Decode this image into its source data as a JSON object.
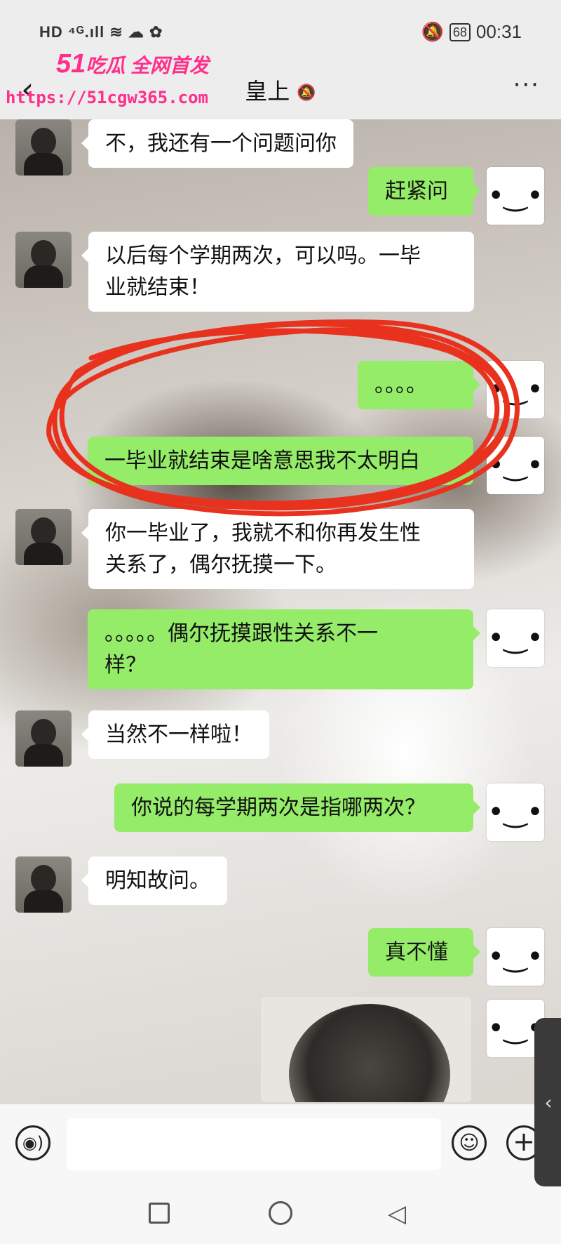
{
  "status_bar": {
    "left_indicators": "HD ⁴ᴳ.ıll ≋ ☁ ✿",
    "battery": "68",
    "time": "00:31"
  },
  "header": {
    "back_icon": "‹",
    "title": "皇上",
    "mute_icon": "🔕",
    "more_icon": "···"
  },
  "watermark": {
    "brand": "51",
    "tagline": "吃瓜 全网首发",
    "url": "https://51cgw365.com"
  },
  "messages": [
    {
      "side": "in",
      "text": "不，我还有一个问题问你"
    },
    {
      "side": "out",
      "text": "赶紧问"
    },
    {
      "side": "in",
      "text": "以后每个学期两次，可以吗。一毕\n业就结束！"
    },
    {
      "side": "out",
      "text": "。。。。"
    },
    {
      "side": "out",
      "text": "一毕业就结束是啥意思我不太明白"
    },
    {
      "side": "in",
      "text": "你一毕业了，我就不和你再发生性\n关系了，偶尔抚摸一下。"
    },
    {
      "side": "out",
      "text": "。。。。。偶尔抚摸跟性关系不一\n样？"
    },
    {
      "side": "in",
      "text": "当然不一样啦！"
    },
    {
      "side": "out",
      "text": "你说的每学期两次是指哪两次？"
    },
    {
      "side": "in",
      "text": "明知故问。"
    },
    {
      "side": "out",
      "text": "真不懂"
    }
  ],
  "avatar_out_face": "•‿•",
  "side_tab_icon": "‹",
  "input_bar": {
    "voice_icon": "◉)",
    "emoji_icon": "☺",
    "plus_icon": "+"
  },
  "nav": {
    "back_icon": "◁"
  },
  "colors": {
    "bubble_out": "#95ec69",
    "bubble_in": "#ffffff",
    "annotation": "#e8321e",
    "watermark": "#ff2e8a"
  }
}
